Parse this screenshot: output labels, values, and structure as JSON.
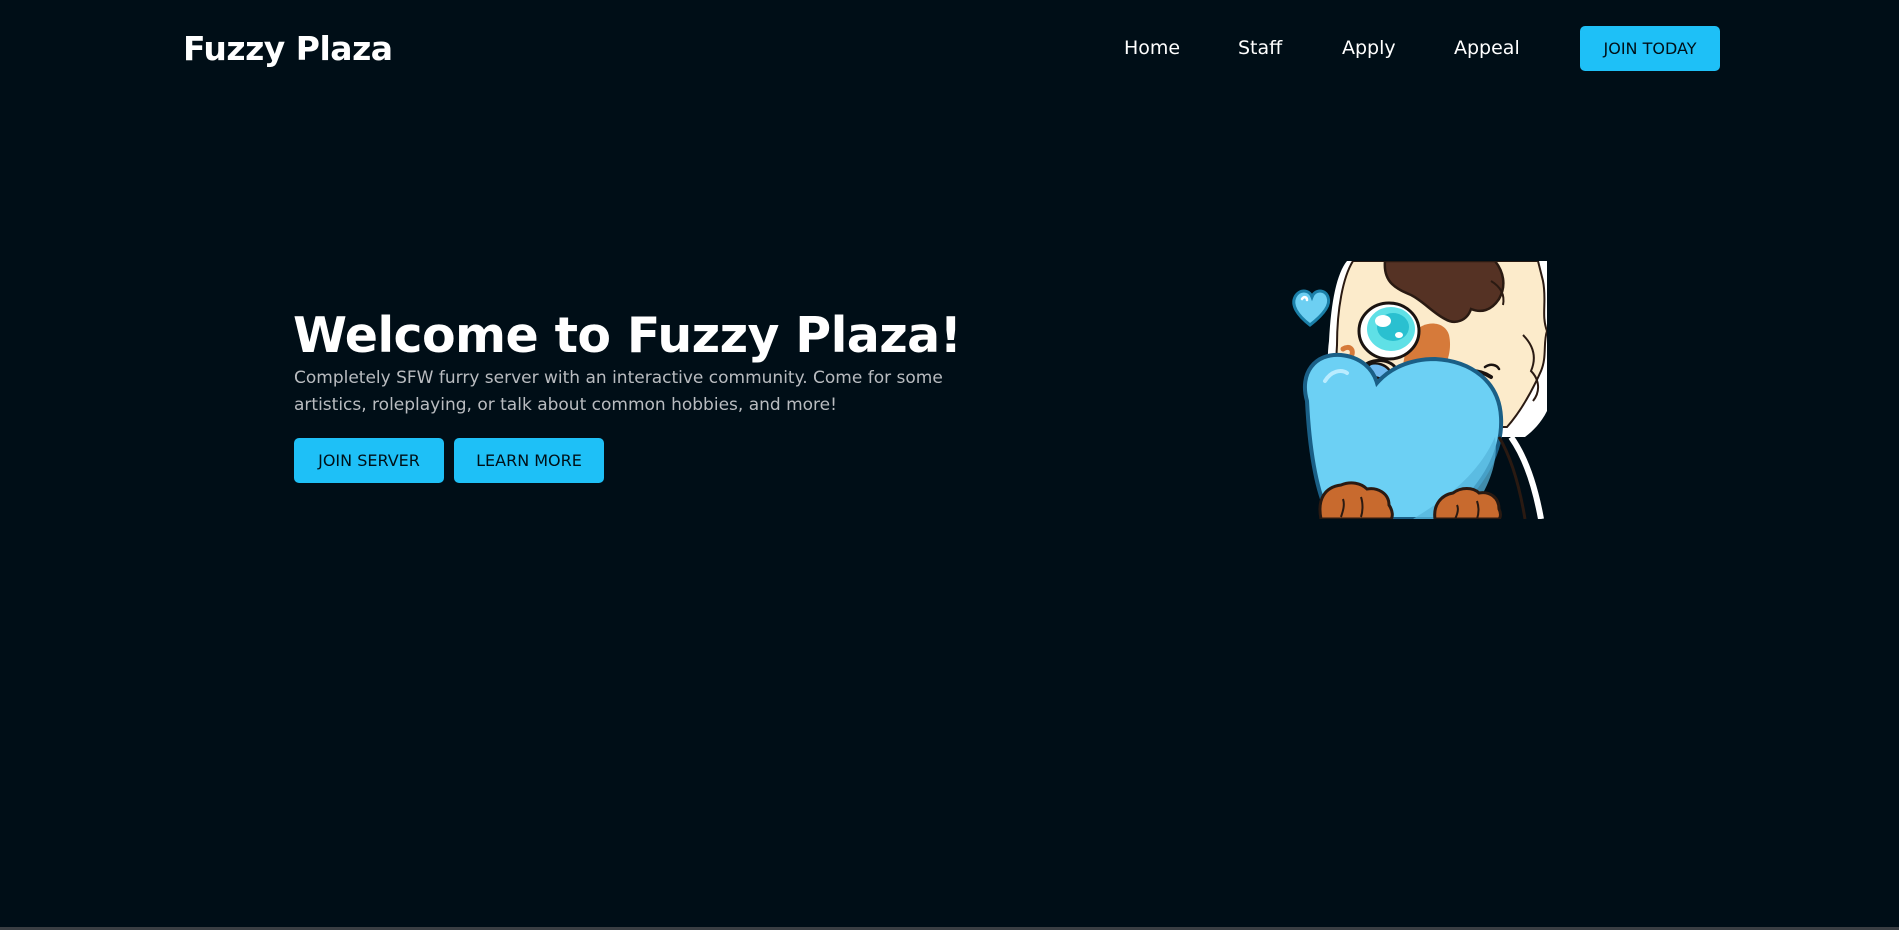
{
  "nav": {
    "brand": "Fuzzy Plaza",
    "links": [
      {
        "label": "Home"
      },
      {
        "label": "Staff"
      },
      {
        "label": "Apply"
      },
      {
        "label": "Appeal"
      }
    ],
    "cta_label": "JOIN TODAY"
  },
  "hero": {
    "title": "Welcome to Fuzzy Plaza!",
    "description": "Completely SFW furry server with an interactive community. Come for some artistics, roleplaying, or talk about common hobbies, and more!",
    "primary_button": "JOIN SERVER",
    "secondary_button": "LEARN MORE"
  },
  "colors": {
    "background": "#000e17",
    "accent": "#1ec0f7",
    "text_primary": "#ffffff",
    "text_muted": "#b9bcc0"
  }
}
